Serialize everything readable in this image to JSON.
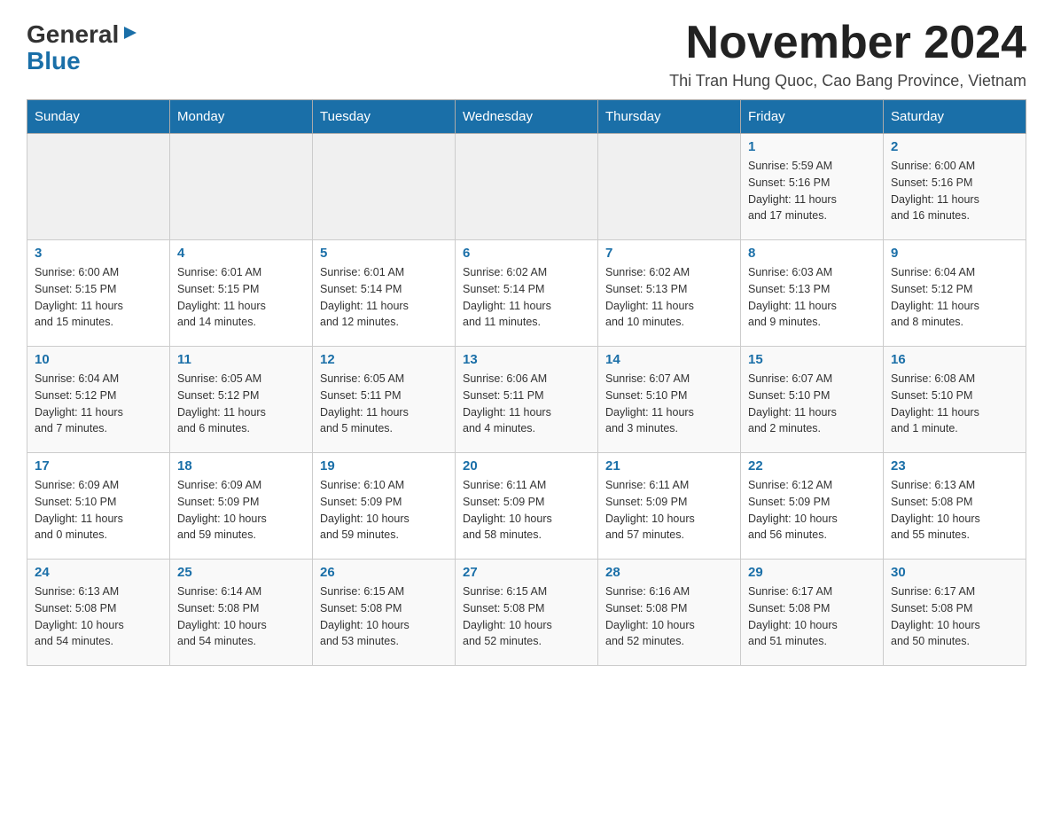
{
  "logo": {
    "general": "General",
    "blue": "Blue",
    "arrow": "▶"
  },
  "title": "November 2024",
  "subtitle": "Thi Tran Hung Quoc, Cao Bang Province, Vietnam",
  "weekdays": [
    "Sunday",
    "Monday",
    "Tuesday",
    "Wednesday",
    "Thursday",
    "Friday",
    "Saturday"
  ],
  "weeks": [
    [
      {
        "day": "",
        "info": ""
      },
      {
        "day": "",
        "info": ""
      },
      {
        "day": "",
        "info": ""
      },
      {
        "day": "",
        "info": ""
      },
      {
        "day": "",
        "info": ""
      },
      {
        "day": "1",
        "info": "Sunrise: 5:59 AM\nSunset: 5:16 PM\nDaylight: 11 hours\nand 17 minutes."
      },
      {
        "day": "2",
        "info": "Sunrise: 6:00 AM\nSunset: 5:16 PM\nDaylight: 11 hours\nand 16 minutes."
      }
    ],
    [
      {
        "day": "3",
        "info": "Sunrise: 6:00 AM\nSunset: 5:15 PM\nDaylight: 11 hours\nand 15 minutes."
      },
      {
        "day": "4",
        "info": "Sunrise: 6:01 AM\nSunset: 5:15 PM\nDaylight: 11 hours\nand 14 minutes."
      },
      {
        "day": "5",
        "info": "Sunrise: 6:01 AM\nSunset: 5:14 PM\nDaylight: 11 hours\nand 12 minutes."
      },
      {
        "day": "6",
        "info": "Sunrise: 6:02 AM\nSunset: 5:14 PM\nDaylight: 11 hours\nand 11 minutes."
      },
      {
        "day": "7",
        "info": "Sunrise: 6:02 AM\nSunset: 5:13 PM\nDaylight: 11 hours\nand 10 minutes."
      },
      {
        "day": "8",
        "info": "Sunrise: 6:03 AM\nSunset: 5:13 PM\nDaylight: 11 hours\nand 9 minutes."
      },
      {
        "day": "9",
        "info": "Sunrise: 6:04 AM\nSunset: 5:12 PM\nDaylight: 11 hours\nand 8 minutes."
      }
    ],
    [
      {
        "day": "10",
        "info": "Sunrise: 6:04 AM\nSunset: 5:12 PM\nDaylight: 11 hours\nand 7 minutes."
      },
      {
        "day": "11",
        "info": "Sunrise: 6:05 AM\nSunset: 5:12 PM\nDaylight: 11 hours\nand 6 minutes."
      },
      {
        "day": "12",
        "info": "Sunrise: 6:05 AM\nSunset: 5:11 PM\nDaylight: 11 hours\nand 5 minutes."
      },
      {
        "day": "13",
        "info": "Sunrise: 6:06 AM\nSunset: 5:11 PM\nDaylight: 11 hours\nand 4 minutes."
      },
      {
        "day": "14",
        "info": "Sunrise: 6:07 AM\nSunset: 5:10 PM\nDaylight: 11 hours\nand 3 minutes."
      },
      {
        "day": "15",
        "info": "Sunrise: 6:07 AM\nSunset: 5:10 PM\nDaylight: 11 hours\nand 2 minutes."
      },
      {
        "day": "16",
        "info": "Sunrise: 6:08 AM\nSunset: 5:10 PM\nDaylight: 11 hours\nand 1 minute."
      }
    ],
    [
      {
        "day": "17",
        "info": "Sunrise: 6:09 AM\nSunset: 5:10 PM\nDaylight: 11 hours\nand 0 minutes."
      },
      {
        "day": "18",
        "info": "Sunrise: 6:09 AM\nSunset: 5:09 PM\nDaylight: 10 hours\nand 59 minutes."
      },
      {
        "day": "19",
        "info": "Sunrise: 6:10 AM\nSunset: 5:09 PM\nDaylight: 10 hours\nand 59 minutes."
      },
      {
        "day": "20",
        "info": "Sunrise: 6:11 AM\nSunset: 5:09 PM\nDaylight: 10 hours\nand 58 minutes."
      },
      {
        "day": "21",
        "info": "Sunrise: 6:11 AM\nSunset: 5:09 PM\nDaylight: 10 hours\nand 57 minutes."
      },
      {
        "day": "22",
        "info": "Sunrise: 6:12 AM\nSunset: 5:09 PM\nDaylight: 10 hours\nand 56 minutes."
      },
      {
        "day": "23",
        "info": "Sunrise: 6:13 AM\nSunset: 5:08 PM\nDaylight: 10 hours\nand 55 minutes."
      }
    ],
    [
      {
        "day": "24",
        "info": "Sunrise: 6:13 AM\nSunset: 5:08 PM\nDaylight: 10 hours\nand 54 minutes."
      },
      {
        "day": "25",
        "info": "Sunrise: 6:14 AM\nSunset: 5:08 PM\nDaylight: 10 hours\nand 54 minutes."
      },
      {
        "day": "26",
        "info": "Sunrise: 6:15 AM\nSunset: 5:08 PM\nDaylight: 10 hours\nand 53 minutes."
      },
      {
        "day": "27",
        "info": "Sunrise: 6:15 AM\nSunset: 5:08 PM\nDaylight: 10 hours\nand 52 minutes."
      },
      {
        "day": "28",
        "info": "Sunrise: 6:16 AM\nSunset: 5:08 PM\nDaylight: 10 hours\nand 52 minutes."
      },
      {
        "day": "29",
        "info": "Sunrise: 6:17 AM\nSunset: 5:08 PM\nDaylight: 10 hours\nand 51 minutes."
      },
      {
        "day": "30",
        "info": "Sunrise: 6:17 AM\nSunset: 5:08 PM\nDaylight: 10 hours\nand 50 minutes."
      }
    ]
  ]
}
